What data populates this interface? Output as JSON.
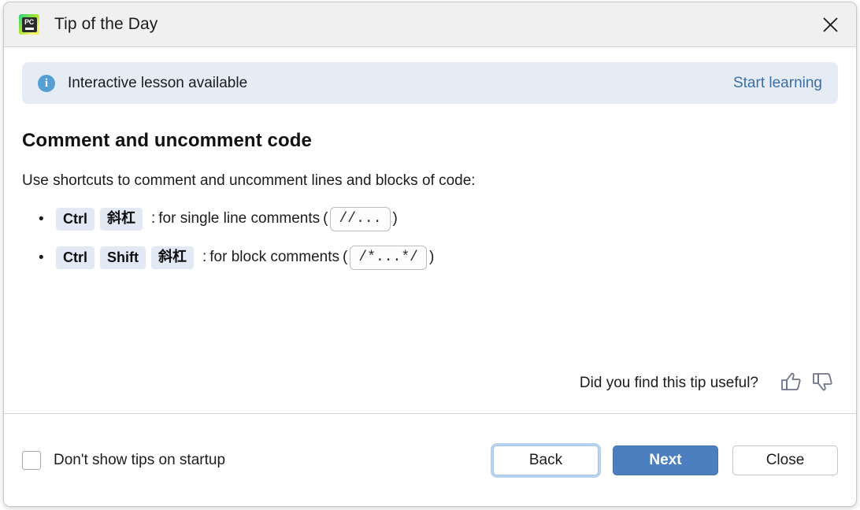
{
  "window": {
    "title": "Tip of the Day",
    "app_icon_name": "pycharm-logo",
    "app_icon_text": "PC",
    "close_icon": "close-x-icon"
  },
  "banner": {
    "icon": "info-circle-icon",
    "icon_glyph": "i",
    "label": "Interactive lesson available",
    "action_label": "Start learning",
    "background_color": "#e5ecf6",
    "link_color": "#3b6ea8"
  },
  "tip": {
    "title": "Comment and uncomment code",
    "intro": "Use shortcuts to comment and uncomment lines and blocks of code:",
    "bullet_glyph": "•",
    "shortcuts": [
      {
        "keys": [
          "Ctrl",
          "斜杠"
        ],
        "separator": ":",
        "description": "for single line comments",
        "open_paren": "(",
        "code": "//...",
        "close_paren": ")"
      },
      {
        "keys": [
          "Ctrl",
          "Shift",
          "斜杠"
        ],
        "separator": ":",
        "description": "for block comments",
        "open_paren": "(",
        "code": "/*...*/",
        "close_paren": ")"
      }
    ]
  },
  "feedback": {
    "question": "Did you find this tip useful?",
    "thumbs_up_icon": "thumbs-up-icon",
    "thumbs_down_icon": "thumbs-down-icon"
  },
  "footer": {
    "checkbox_label": "Don't show tips on startup",
    "checkbox_checked": false,
    "buttons": {
      "back": "Back",
      "next": "Next",
      "close": "Close"
    },
    "default_button_color": "#4c7fc0",
    "focus_ring_color": "#b6d2f0"
  }
}
